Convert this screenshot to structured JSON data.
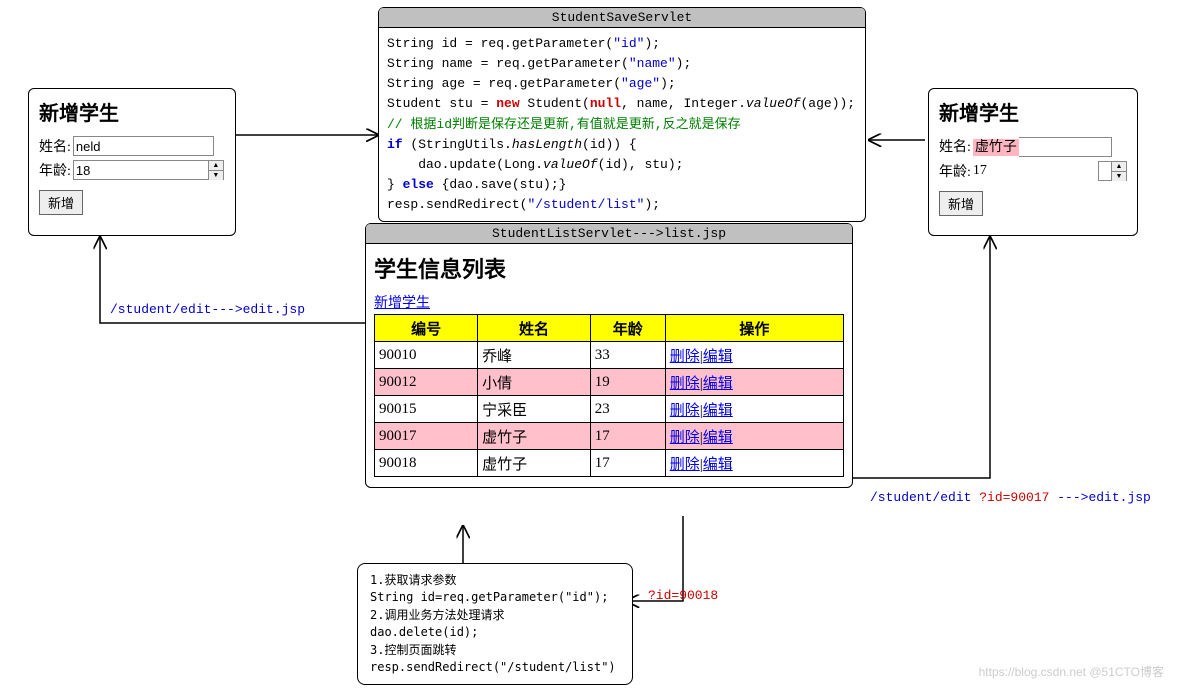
{
  "save_servlet": {
    "title": "StudentSaveServlet",
    "line1": "String id = req.getParameter(",
    "str1": "\"id\"",
    "line1e": ");",
    "line2": "String name = req.getParameter(",
    "str2": "\"name\"",
    "line2e": ");",
    "line3": "String age = req.getParameter(",
    "str3": "\"age\"",
    "line3e": ");",
    "line4a": "Student stu = ",
    "new": "new",
    "line4b": " Student(",
    "null": "null",
    "line4c": ", name, Integer.",
    "valueOf1": "valueOf",
    "line4d": "(age));",
    "comment": "// 根据id判断是保存还是更新,有值就是更新,反之就是保存",
    "if": "if",
    "line5a": " (StringUtils.",
    "hasLength": "hasLength",
    "line5b": "(id)) {",
    "line6a": "    dao.update(Long.",
    "valueOf2": "valueOf",
    "line6b": "(id), stu);",
    "line7a": "} ",
    "else": "else",
    "line7b": " {dao.save(stu);}",
    "line8a": "resp.sendRedirect(",
    "str8": "\"/student/list\"",
    "line8b": ");"
  },
  "form_left": {
    "title": "新增学生",
    "name_label": "姓名:",
    "name_value": "neld",
    "age_label": "年龄:",
    "age_value": "18",
    "submit": "新增"
  },
  "form_right": {
    "title": "新增学生",
    "name_label": "姓名:",
    "name_value": "虚竹子",
    "age_label": "年龄:",
    "age_value": "17",
    "submit": "新增"
  },
  "list_servlet": {
    "title": "StudentListServlet--->list.jsp",
    "heading": "学生信息列表",
    "add_link": "新增学生",
    "headers": [
      "编号",
      "姓名",
      "年龄",
      "操作"
    ],
    "op_delete": "删除",
    "op_edit": "编辑",
    "rows": [
      {
        "id": "90010",
        "name": "乔峰",
        "age": "33",
        "pink": false
      },
      {
        "id": "90012",
        "name": "小倩",
        "age": "19",
        "pink": true
      },
      {
        "id": "90015",
        "name": "宁采臣",
        "age": "23",
        "pink": false
      },
      {
        "id": "90017",
        "name": "虚竹子",
        "age": "17",
        "pink": true
      },
      {
        "id": "90018",
        "name": "虚竹子",
        "age": "17",
        "pink": false
      }
    ]
  },
  "note": {
    "l1": "1.获取请求参数",
    "l2": "String id=req.getParameter(\"id\");",
    "l3": "2.调用业务方法处理请求",
    "l4": "dao.delete(id);",
    "l5": "3.控制页面跳转",
    "l6": "resp.sendRedirect(\"/student/list\")"
  },
  "labels": {
    "left_path": "/student/edit--->edit.jsp",
    "right_path_a": "/student/edit ",
    "right_path_b": "?id=90017 ",
    "right_path_c": "--->edit.jsp",
    "id_param": "?id=90018"
  },
  "watermark": "https://blog.csdn.net  @51CTO博客"
}
